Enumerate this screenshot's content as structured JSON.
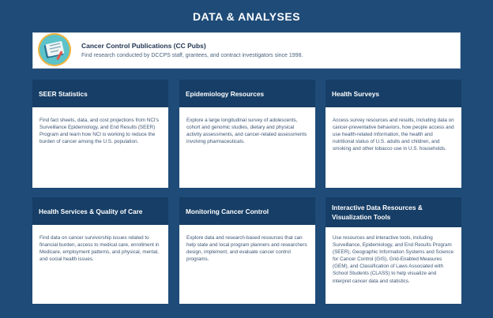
{
  "header": {
    "title": "DATA & ANALYSES"
  },
  "featured": {
    "title": "Cancer Control Publications (CC Pubs)",
    "description": "Find research conducted by DCCPS staff, grantees, and contract investigators since 1998.",
    "icon": "publications-icon"
  },
  "cards": [
    {
      "title": "SEER Statistics",
      "body": "Find fact sheets, data, and cost projections from NCI's Surveillance Epidemiology, and End Results (SEER) Program and learn how NCI is working to reduce the burden of cancer among the U.S. population."
    },
    {
      "title": "Epidemiology Resources",
      "body": "Explore a large longitudinal survey of adolescents, cohort and genomic studies, dietary and physical activity assessments, and cancer-related assessments involving pharmaceuticals."
    },
    {
      "title": "Health Surveys",
      "body": "Access survey resources and results, including data on cancer-preventative behaviors, how people access and use health-related information, the health and nutritional status of U.S. adults and children, and smoking and other tobacco use in U.S. households."
    },
    {
      "title": "Health Services & Quality of Care",
      "body": "Find data on cancer survivorship issues related to financial burden, access to medical care, enrollment in Medicare, employment patterns, and physical, mental, and social health issues."
    },
    {
      "title": "Monitoring Cancer Control",
      "body": "Explore data and research-based resources that can help state and local program planners and researchers design, implement, and evaluate cancer control programs."
    },
    {
      "title": "Interactive Data Resources & Visualization Tools",
      "body": "Use resources and interactive tools, including Surveillance, Epidemiology, and End Results Program (SEER), Geographic Information Systems and Science for Cancer Control (GIS), Grid-Enabled Measures (GEM), and Classification of Laws Associated with School Students (CLASS) to help visualize and interpret cancer data and statistics."
    }
  ]
}
